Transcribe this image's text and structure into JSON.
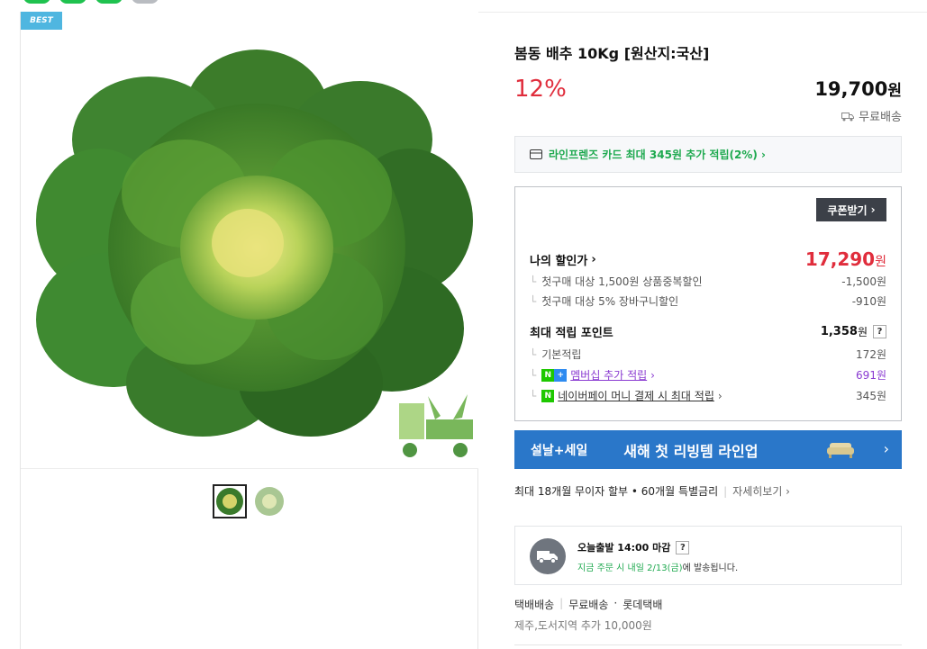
{
  "badge": "BEST",
  "product": {
    "title": "봄동 배추 10Kg [원산지:국산]",
    "discount": "12%",
    "price": "19,700",
    "price_unit": "원",
    "shipping": "무료배송"
  },
  "card_promo": "라인프렌즈 카드 최대 345원 추가 적립(2%) ›",
  "coupon": {
    "button": "쿠폰받기",
    "my_price_label": "나의 할인가",
    "my_price": "17,290",
    "my_price_unit": "원",
    "discounts": [
      {
        "label": "첫구매 대상 1,500원 상품중복할인",
        "value": "-1,500원"
      },
      {
        "label": "첫구매 대상 5% 장바구니할인",
        "value": "-910원"
      }
    ],
    "points_label": "최대 적립 포인트",
    "points": "1,358",
    "points_unit": "원",
    "point_items": [
      {
        "label": "기본적립",
        "value": "172원"
      },
      {
        "label": "멤버십 추가 적립",
        "value": "691원"
      },
      {
        "label": "네이버페이 머니 결제 시 최대 적립",
        "value": "345원"
      }
    ]
  },
  "banner": {
    "left": "설날+세일",
    "main": "새해 첫 리빙템 라인업"
  },
  "installment": {
    "text": "최대 18개월 무이자 할부 • 60개월 특별금리",
    "more": "자세히보기 ›"
  },
  "delivery": {
    "title": "오늘출발 14:00 마감",
    "q": "?",
    "green": "지금 주문 시 내일 2/13(금)",
    "rest": "에 발송됩니다."
  },
  "ship_info": {
    "method": "택배배송",
    "fee": "무료배송",
    "carrier": "롯데택배",
    "extra": "제주,도서지역 추가 10,000원"
  },
  "colors": {
    "accent_red": "#e02d3c",
    "naver_green": "#1ea94f",
    "banner_blue": "#2a77c9",
    "purple": "#8a3bd1"
  }
}
